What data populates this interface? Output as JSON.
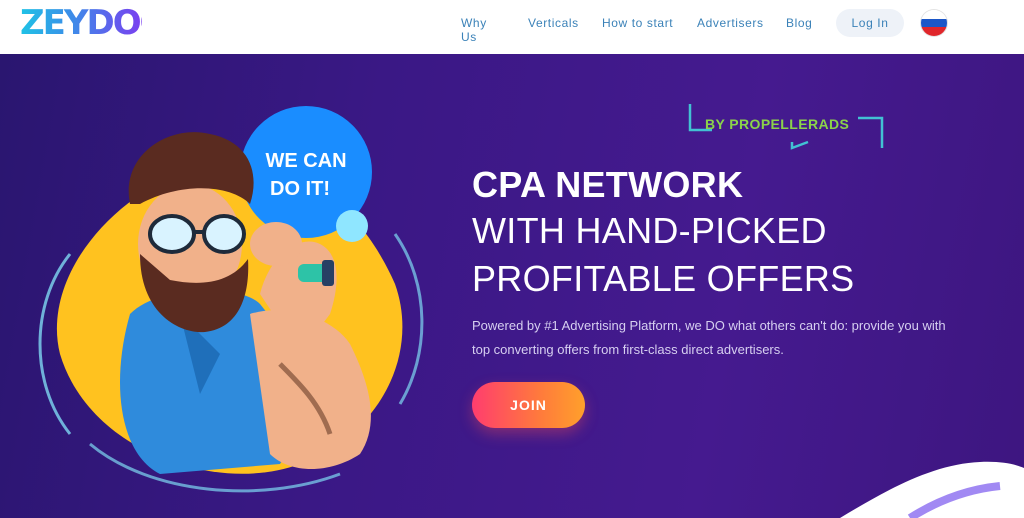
{
  "header": {
    "logo_text": "ZEYDOO",
    "nav": [
      "Why Us",
      "Verticals",
      "How to start",
      "Advertisers",
      "Blog"
    ],
    "login_label": "Log In",
    "language_flag": "russia-flag-icon"
  },
  "hero": {
    "badge": "BY PROPELLERADS",
    "title_line1": "CPA NETWORK",
    "title_line2": "WITH HAND-PICKED",
    "title_line3": "PROFITABLE OFFERS",
    "description": "Powered by #1 Advertising Platform, we DO what others can't do: provide you with top converting offers from first-class direct advertisers.",
    "join_label": "JOIN",
    "illustration_speech": "WE CAN DO IT!"
  },
  "colors": {
    "accent": "#3b82b8",
    "hero_bg": "#3a1885",
    "badge_green": "#8bd34a",
    "join_gradient_start": "#ff3d6e",
    "join_gradient_end": "#ffa02b"
  }
}
